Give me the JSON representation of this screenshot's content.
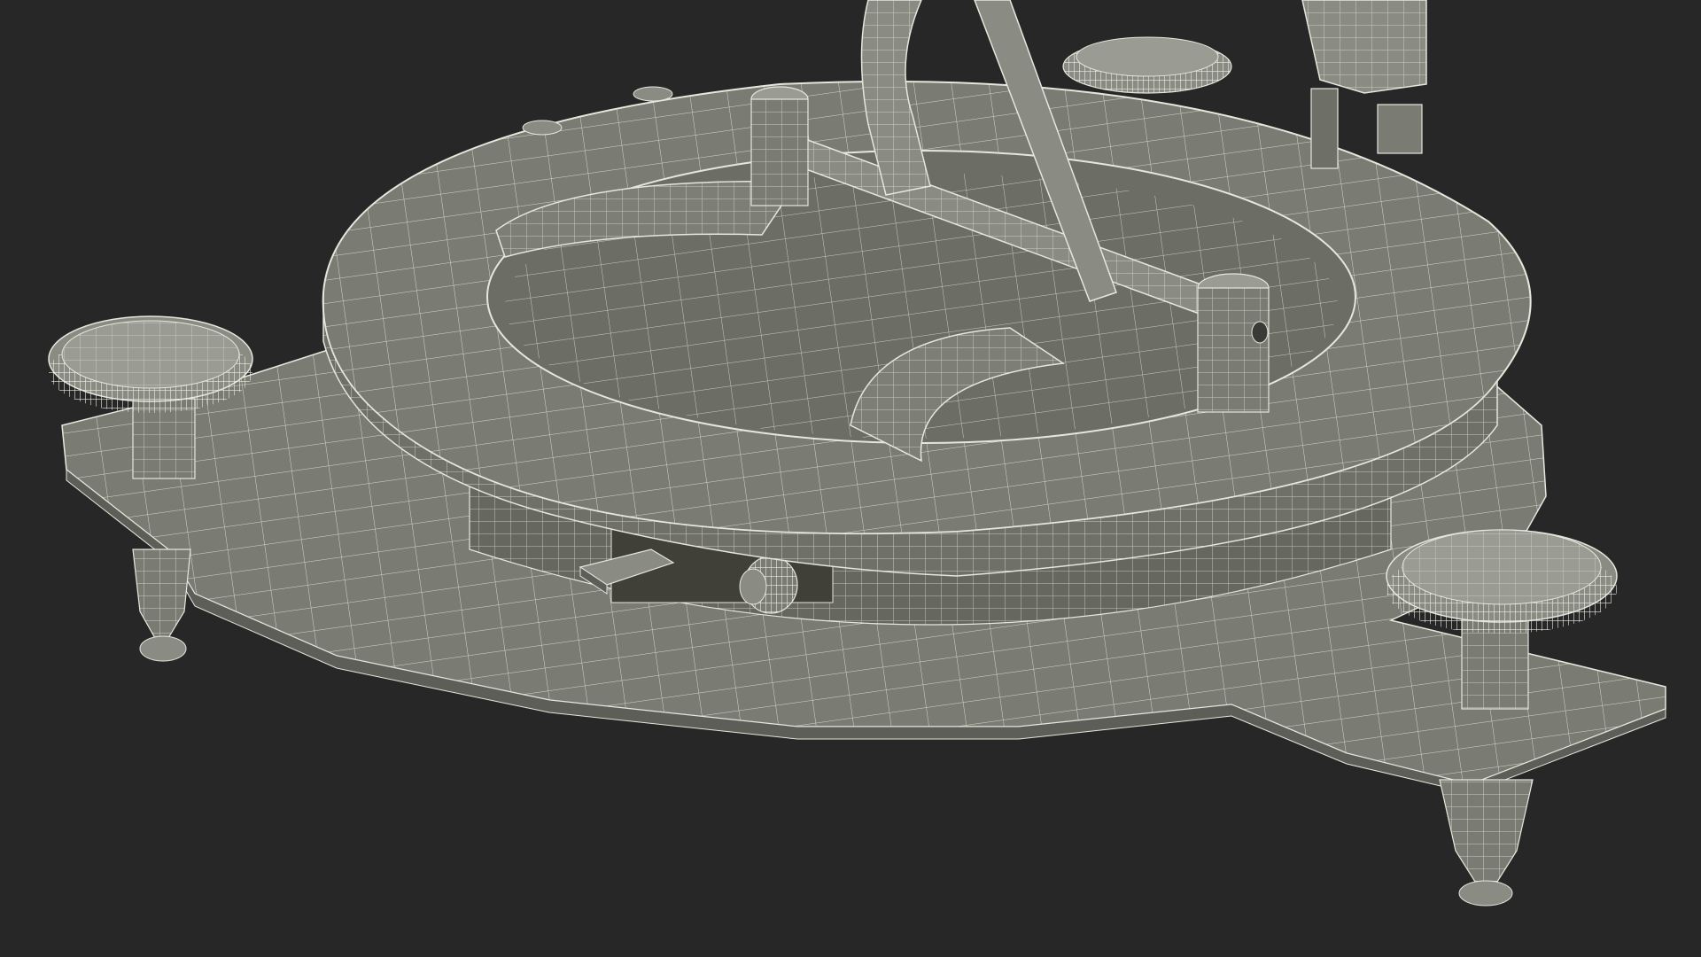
{
  "scene": {
    "subject": "wireframe-render-sundial-compass-instrument",
    "colors": {
      "background": "#272727",
      "surface": "#7a7b72",
      "surface_light": "#8a8b82",
      "surface_dark": "#5d5e57",
      "wire": "#e6e6dd",
      "shadow": "#3a3a37"
    }
  }
}
